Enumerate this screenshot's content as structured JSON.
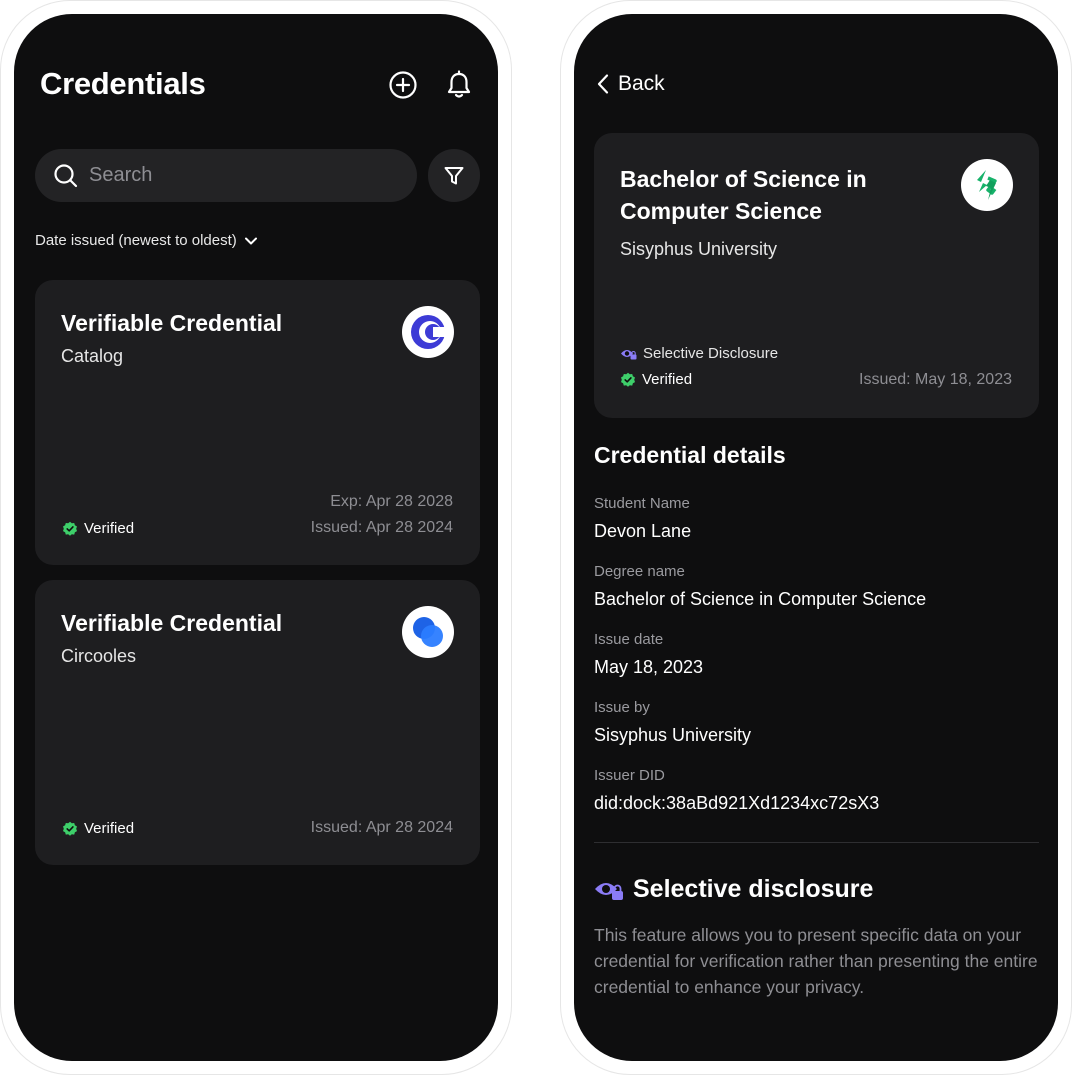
{
  "colors": {
    "background": "#0e0e0f",
    "card": "#1e1e20",
    "verified_green": "#3ecf6a",
    "accent_purple": "#8b7cf6"
  },
  "credentials_screen": {
    "title": "Credentials",
    "icons": {
      "add": "plus-circle-icon",
      "notifications": "bell-icon",
      "search": "search-icon",
      "filter": "filter-icon"
    },
    "search": {
      "placeholder": "Search"
    },
    "sort_label": "Date issued (newest to oldest)",
    "cards": [
      {
        "name": "Verifiable Credential",
        "issuer": "Catalog",
        "status": "Verified",
        "expiry": "Exp: Apr 28 2028",
        "issued": "Issued: Apr 28 2024",
        "logo": "catalog-logo"
      },
      {
        "name": "Verifiable Credential",
        "issuer": "Circooles",
        "status": "Verified",
        "issued": "Issued: Apr 28 2024",
        "logo": "circooles-logo"
      }
    ]
  },
  "detail_screen": {
    "back_label": "Back",
    "card": {
      "title": "Bachelor of Science in Computer Science",
      "issuer": "Sisyphus University",
      "selective_disclosure": "Selective Disclosure",
      "status": "Verified",
      "issued": "Issued: May 18, 2023",
      "logo": "sisyphus-logo"
    },
    "details_title": "Credential details",
    "fields": [
      {
        "label": "Student Name",
        "value": "Devon Lane"
      },
      {
        "label": "Degree name",
        "value": "Bachelor of Science in Computer Science"
      },
      {
        "label": "Issue date",
        "value": "May 18, 2023"
      },
      {
        "label": "Issue by",
        "value": "Sisyphus University"
      },
      {
        "label": "Issuer DID",
        "value": "did:dock:38aBd921Xd1234xc72sX3"
      }
    ],
    "selective_disclosure": {
      "title": "Selective disclosure",
      "body": "This feature allows you to present specific data on your credential for verification rather than presenting the entire credential to enhance your privacy."
    }
  }
}
